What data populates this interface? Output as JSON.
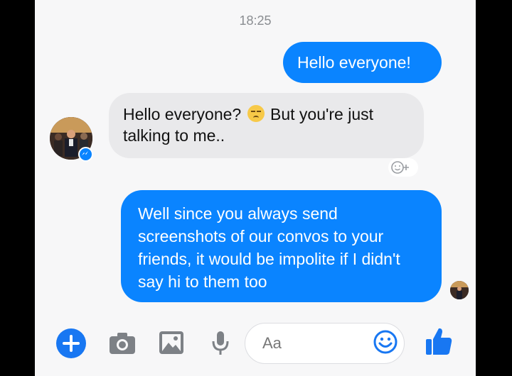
{
  "conversation": {
    "timestamp": "18:25",
    "messages": [
      {
        "sender": "me",
        "text": "Hello everyone!"
      },
      {
        "sender": "other",
        "text_before_emoji": "Hello everyone? ",
        "emoji": "unamused-face",
        "text_after_emoji": " But you're just talking to me.."
      },
      {
        "sender": "me",
        "text": "Well since you always send screenshots of our convos to your friends, it would be impolite if I didn't say hi to them too"
      }
    ]
  },
  "composer": {
    "placeholder": "Aa"
  },
  "icons": {
    "add": "plus-icon",
    "camera": "camera-icon",
    "gallery": "image-icon",
    "voice": "microphone-icon",
    "emoji": "smiley-icon",
    "like": "thumbs-up-icon",
    "react": "add-reaction-icon",
    "messenger_badge": "messenger-badge-icon"
  },
  "colors": {
    "outgoing_bubble": "#0a84ff",
    "incoming_bubble": "#e9e9eb",
    "accent": "#1877f2"
  }
}
